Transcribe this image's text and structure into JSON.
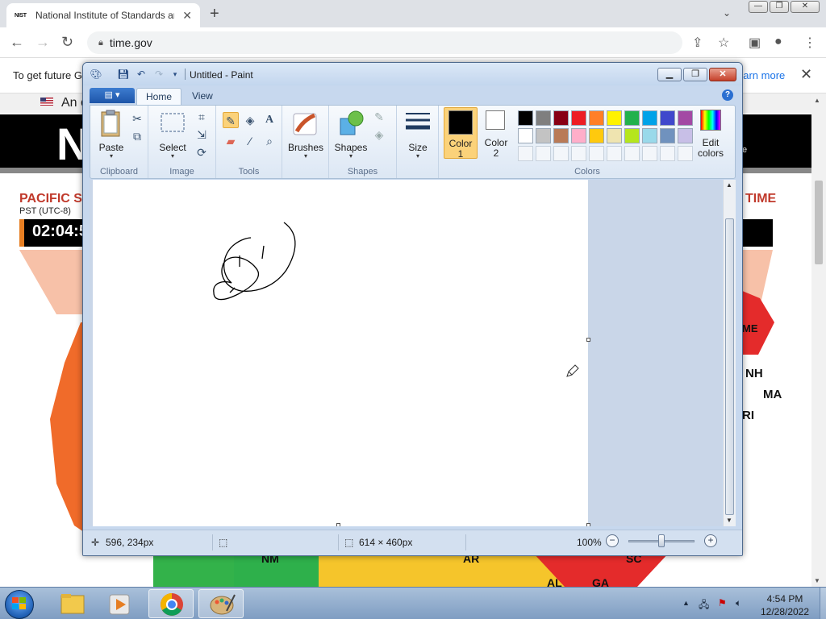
{
  "browser": {
    "tab_favicon": "NIST",
    "tab_title": "National Institute of Standards an",
    "tab_close": "✕",
    "new_tab": "+",
    "url": "time.gov",
    "infobar_text": "To get future G",
    "infobar_link": "earn more",
    "infobar_close": "✕",
    "win_controls": [
      "—",
      "❐",
      "✕"
    ]
  },
  "page": {
    "gov_banner": "An o",
    "nist_initial": "N",
    "band_suffix": "e",
    "pacific_label": "PACIFIC S",
    "pst_label": "PST (UTC-8)",
    "clock_partial": "02:04:5",
    "time_right": "TIME",
    "states": [
      "ME",
      "NH",
      "MA",
      "RI",
      "NM",
      "AR",
      "SC",
      "AL",
      "GA"
    ]
  },
  "paint": {
    "title": "Untitled - Paint",
    "tabs": [
      "Home",
      "View"
    ],
    "groups": {
      "clipboard": {
        "label": "Clipboard",
        "paste": "Paste"
      },
      "image": {
        "label": "Image",
        "select": "Select"
      },
      "tools": {
        "label": "Tools"
      },
      "brushes": {
        "label": "Brushes"
      },
      "shapes": {
        "label": "Shapes",
        "shapes": "Shapes"
      },
      "size": {
        "label": "Size"
      },
      "colors": {
        "label": "Colors",
        "color1": "Color 1",
        "color1_line1": "Color",
        "color1_line2": "1",
        "color2_line1": "Color",
        "color2_line2": "2",
        "edit_line1": "Edit",
        "edit_line2": "colors",
        "palette_row1": [
          "#000000",
          "#7f7f7f",
          "#880015",
          "#ed1c24",
          "#ff7f27",
          "#fff200",
          "#22b14c",
          "#00a2e8",
          "#3f48cc",
          "#a349a4"
        ],
        "palette_row2": [
          "#ffffff",
          "#c3c3c3",
          "#b97a57",
          "#ffaec9",
          "#ffc90e",
          "#efe4b0",
          "#b5e61d",
          "#99d9ea",
          "#7092be",
          "#c8bfe7"
        ],
        "color1_value": "#000000",
        "color2_value": "#ffffff"
      }
    },
    "status": {
      "cursor_pos": "596, 234px",
      "canvas_size": "614 × 460px",
      "zoom": "100%"
    }
  },
  "taskbar": {
    "time": "4:54 PM",
    "date": "12/28/2022",
    "apps": [
      "windows-explorer",
      "media-player",
      "chrome",
      "paint"
    ]
  }
}
